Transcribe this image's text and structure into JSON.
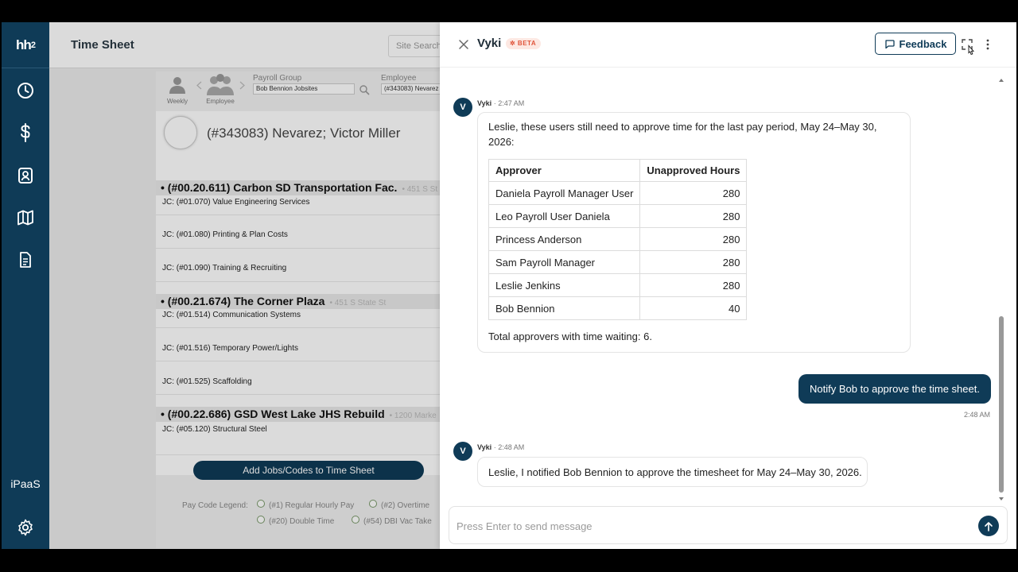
{
  "nav": {
    "ipaas_label": "iPaaS"
  },
  "app": {
    "title": "Time Sheet",
    "site_search_placeholder": "Site Search",
    "timesheet": {
      "weekly_label": "Weekly",
      "employee_label": "Employee",
      "payroll_group_label": "Payroll Group",
      "payroll_group_value": "Bob Bennion Jobsites",
      "employee_field_label": "Employee",
      "employee_field_value": "(#343083) Nevarez",
      "employee_name": "(#343083) Nevarez; Victor Miller",
      "jobs": [
        {
          "title": "• (#00.20.611) Carbon SD Transportation Fac.",
          "address": "• 451 S St"
        },
        {
          "title": "• (#00.21.674) The Corner Plaza",
          "address": "• 451 S State St"
        },
        {
          "title": "• (#00.22.686) GSD West Lake JHS Rebuild",
          "address": "• 1200 Marke"
        }
      ],
      "codes": [
        "JC: (#01.070) Value Engineering Services",
        "JC: (#01.080) Printing & Plan Costs",
        "JC: (#01.090) Training & Recruiting",
        "JC: (#01.514) Communication Systems",
        "JC: (#01.516) Temporary Power/Lights",
        "JC: (#01.525) Scaffolding",
        "JC: (#05.120) Structural Steel"
      ],
      "add_button": "Add Jobs/Codes to Time Sheet",
      "legend_label": "Pay Code Legend:",
      "legend_items": [
        "(#1) Regular Hourly Pay",
        "(#2) Overtime",
        "(#20) Double Time",
        "(#54) DBI Vac Take"
      ]
    }
  },
  "chat": {
    "title": "Vyki",
    "beta_badge": "✲ BETA",
    "feedback_label": "Feedback",
    "messages": {
      "m1": {
        "avatar": "V",
        "sender": "Vyki",
        "time": "2:47 AM",
        "intro": "Leslie, these users still need to approve time for the last pay period, May 24–May 30, 2026:",
        "table": {
          "headers": [
            "Approver",
            "Unapproved Hours"
          ],
          "rows": [
            [
              "Daniela Payroll Manager User",
              "280"
            ],
            [
              "Leo Payroll User Daniela",
              "280"
            ],
            [
              "Princess Anderson",
              "280"
            ],
            [
              "Sam Payroll Manager",
              "280"
            ],
            [
              "Leslie Jenkins",
              "280"
            ],
            [
              "Bob Bennion",
              "40"
            ]
          ]
        },
        "summary": "Total approvers with time waiting: 6."
      },
      "m2": {
        "text": "Notify Bob to approve the time sheet.",
        "time": "2:48 AM"
      },
      "m3": {
        "avatar": "V",
        "sender": "Vyki",
        "time": "2:48 AM",
        "text": "Leslie, I notified Bob Bennion to approve the timesheet for May 24–May 30, 2026."
      }
    },
    "input_placeholder": "Press Enter to send message"
  },
  "colors": {
    "brand": "#0f3b57",
    "beta_text": "#e0553b",
    "beta_bg": "#fde8e2"
  }
}
